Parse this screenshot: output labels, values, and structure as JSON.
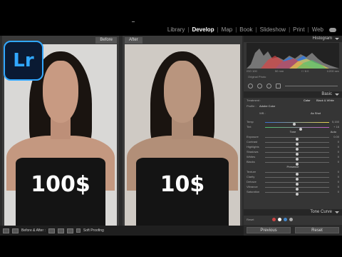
{
  "app": {
    "logo_text": "Lr"
  },
  "modules": {
    "items": [
      {
        "label": "Library",
        "active": false
      },
      {
        "label": "Develop",
        "active": true
      },
      {
        "label": "Map",
        "active": false
      },
      {
        "label": "Book",
        "active": false
      },
      {
        "label": "Slideshow",
        "active": false
      },
      {
        "label": "Print",
        "active": false
      },
      {
        "label": "Web",
        "active": false
      }
    ],
    "separator": "|"
  },
  "panes": {
    "before_label": "Before",
    "after_label": "After",
    "before_price": "100$",
    "after_price": "10$"
  },
  "toolbar": {
    "view_mode_label": "Before & After :",
    "soft_proofing_label": "Soft Proofing"
  },
  "histogram": {
    "title": "Histogram",
    "readouts": [
      "ISO 100",
      "50 mm",
      "f / 8.0",
      "1/200 sec"
    ],
    "original_photo_label": "Original Photo"
  },
  "basic": {
    "title": "Basic",
    "treatment_label": "Treatment :",
    "treatment_color": "Color",
    "treatment_bw": "Black & White",
    "profile_label": "Profile :",
    "profile_value": "Adobe Color",
    "wb_label": "WB :",
    "wb_value": "As Shot",
    "temp": {
      "label": "Temp",
      "value": "5,150",
      "level": 0.45
    },
    "tint": {
      "label": "Tint",
      "value": "+ 16",
      "level": 0.55
    },
    "tone_label": "Tone",
    "tone_auto": "Auto",
    "tone_rows": [
      {
        "label": "Exposure",
        "value": "0.00",
        "level": 0.5
      },
      {
        "label": "Contrast",
        "value": "0",
        "level": 0.5
      },
      {
        "label": "Highlights",
        "value": "0",
        "level": 0.5
      },
      {
        "label": "Shadows",
        "value": "0",
        "level": 0.5
      },
      {
        "label": "Whites",
        "value": "0",
        "level": 0.5
      },
      {
        "label": "Blacks",
        "value": "0",
        "level": 0.5
      }
    ],
    "presence_label": "Presence",
    "presence_rows": [
      {
        "label": "Texture",
        "value": "0",
        "level": 0.5
      },
      {
        "label": "Clarity",
        "value": "0",
        "level": 0.5
      },
      {
        "label": "Dehaze",
        "value": "0",
        "level": 0.5
      },
      {
        "label": "Vibrance",
        "value": "0",
        "level": 0.5
      },
      {
        "label": "Saturation",
        "value": "0",
        "level": 0.5
      }
    ]
  },
  "tone_curve": {
    "title": "Tone Curve"
  },
  "reset_row": {
    "label": "Reset"
  },
  "buttons": {
    "previous": "Previous",
    "reset": "Reset"
  },
  "colors": {
    "lr_blue": "#31a8ff",
    "lr_bg": "#0a1a33",
    "panel": "#353535"
  },
  "icons": [
    "lightroom-logo-icon",
    "cloud-icon",
    "eyedropper-icon",
    "crop-icon",
    "heal-icon",
    "redeye-icon",
    "mask-icon"
  ]
}
